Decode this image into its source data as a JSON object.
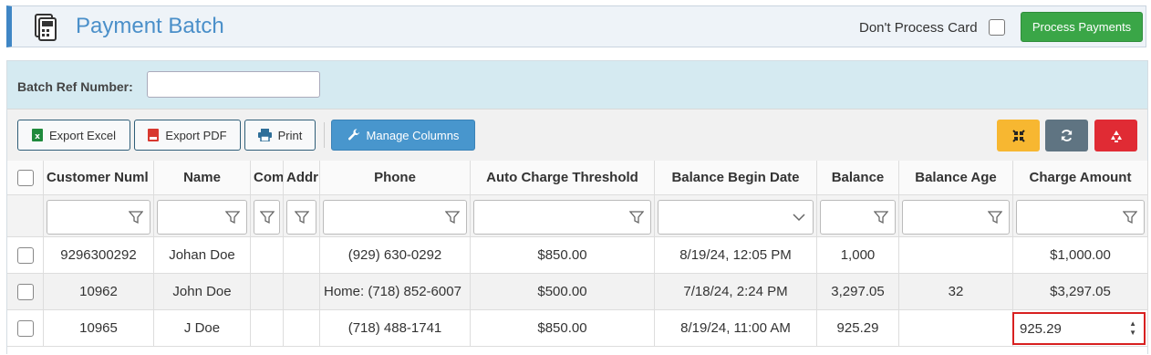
{
  "header": {
    "title": "Payment Batch",
    "dont_process_card_label": "Don't Process Card",
    "process_payments_label": "Process Payments"
  },
  "filter": {
    "batch_ref_label": "Batch Ref Number:",
    "batch_ref_value": ""
  },
  "toolbar": {
    "export_excel": "Export Excel",
    "export_pdf": "Export PDF",
    "print": "Print",
    "manage_columns": "Manage Columns",
    "colors": {
      "collapse": "#f7b731",
      "refresh": "#5f7482",
      "recycle": "#e02b34"
    }
  },
  "grid": {
    "columns": [
      "Customer Numl",
      "Name",
      "Com",
      "Addr",
      "Phone",
      "Auto Charge Threshold",
      "Balance Begin Date",
      "Balance",
      "Balance Age",
      "Charge Amount"
    ],
    "rows": [
      {
        "customer": "9296300292",
        "name": "Johan Doe",
        "com": "",
        "addr": "",
        "phone": "(929) 630-0292",
        "threshold": "$850.00",
        "begin_date": "8/19/24, 12:05 PM",
        "balance": "1,000",
        "age": "",
        "charge": "$1,000.00"
      },
      {
        "customer": "10962",
        "name": "John Doe",
        "com": "",
        "addr": "",
        "phone": "Home: (718) 852-6007",
        "threshold": "$500.00",
        "begin_date": "7/18/24, 2:24 PM",
        "balance": "3,297.05",
        "age": "32",
        "charge": "$3,297.05"
      },
      {
        "customer": "10965",
        "name": "J Doe",
        "com": "",
        "addr": "",
        "phone": "(718) 488-1741",
        "threshold": "$850.00",
        "begin_date": "8/19/24, 11:00 AM",
        "balance": "925.29",
        "age": "",
        "charge": "925.29"
      }
    ]
  }
}
